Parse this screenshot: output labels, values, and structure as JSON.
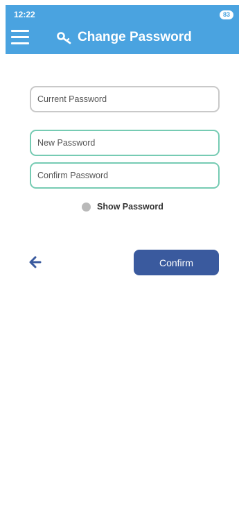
{
  "status_bar": {
    "time": "12:22",
    "battery": "83"
  },
  "header": {
    "title": "Change Password",
    "menu_icon": "hamburger-menu-icon",
    "title_icon": "key-icon",
    "background_color": "#4aa3e0"
  },
  "form": {
    "current_password": {
      "placeholder": "Current Password",
      "value": ""
    },
    "new_password": {
      "placeholder": "New Password",
      "value": ""
    },
    "confirm_password": {
      "placeholder": "Confirm Password",
      "value": ""
    },
    "show_password_label": "Show Password",
    "show_password_checked": false
  },
  "actions": {
    "back_icon": "arrow-left-icon",
    "confirm_label": "Confirm",
    "confirm_color": "#3a5a9e"
  },
  "colors": {
    "field_border": "#c9c9c9",
    "field_border_active": "#76cbb3"
  }
}
